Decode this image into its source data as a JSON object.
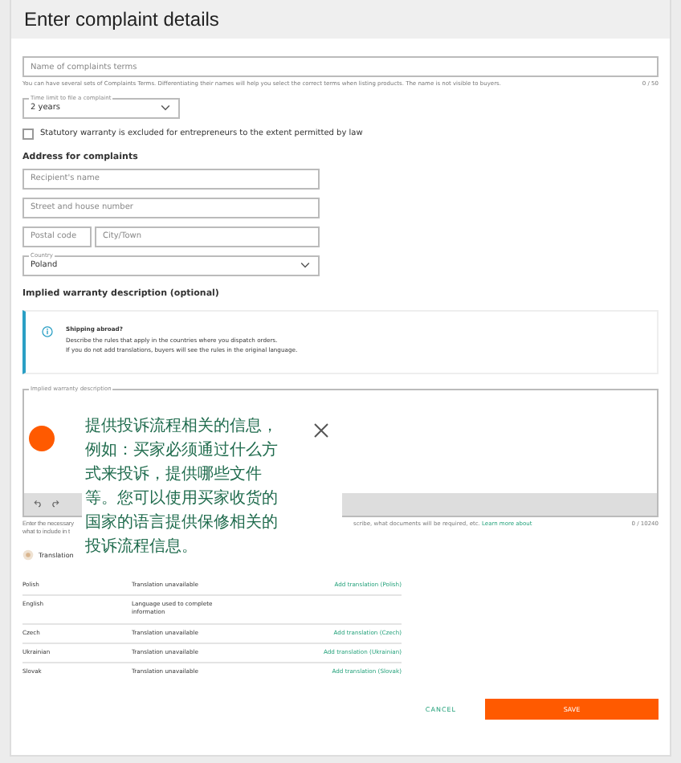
{
  "title": "Enter complaint details",
  "name_field": {
    "placeholder": "Name of complaints terms",
    "helper": "You can have several sets of Complaints Terms. Differentiating their names will help you select the correct terms when listing products. The name is not visible to buyers.",
    "counter": "0 / 50"
  },
  "time_limit": {
    "label": "Time limit to file a complaint",
    "value": "2 years"
  },
  "warranty_checkbox": {
    "label": "Statutory warranty is excluded for entrepreneurs to the extent permitted by law",
    "checked": false
  },
  "address": {
    "heading": "Address for complaints",
    "recipient": {
      "placeholder": "Recipient's name"
    },
    "street": {
      "placeholder": "Street and house number"
    },
    "postal": {
      "placeholder": "Postal code"
    },
    "city": {
      "placeholder": "City/Town"
    },
    "country": {
      "label": "Country",
      "value": "Poland"
    }
  },
  "implied": {
    "heading": "Implied warranty description (optional)",
    "info_title": "Shipping abroad?",
    "info_lines": [
      "Describe the rules that apply in the countries where you dispatch orders.",
      "If you do not add translations, buyers will see the rules in the original language."
    ],
    "editor_label": "Implied warranty description",
    "helper_left": [
      "Enter the necessary",
      "what to include in t"
    ],
    "helper_right": "scribe, what documents will be required, etc.",
    "helper_link": "Learn more about",
    "counter": "0 / 10240"
  },
  "tooltip": {
    "text": "提供投诉流程相关的信息，例如：买家必须通过什么方式来投诉，提供哪些文件等。您可以使用买家收货的国家的语言提供保修相关的投诉流程信息。"
  },
  "translation_label": "Translation",
  "translations": [
    {
      "language": "Polish",
      "status": "Translation unavailable",
      "action": "Add translation (Polish)"
    },
    {
      "language": "English",
      "status": "Language used to complete information"
    },
    {
      "language": "Czech",
      "status": "Translation unavailable",
      "action": "Add translation (Czech)"
    },
    {
      "language": "Ukrainian",
      "status": "Translation unavailable",
      "action": "Add translation (Ukrainian)"
    },
    {
      "language": "Slovak",
      "status": "Translation unavailable",
      "action": "Add translation (Slovak)"
    }
  ],
  "buttons": {
    "cancel": "CANCEL",
    "save": "SAVE"
  }
}
